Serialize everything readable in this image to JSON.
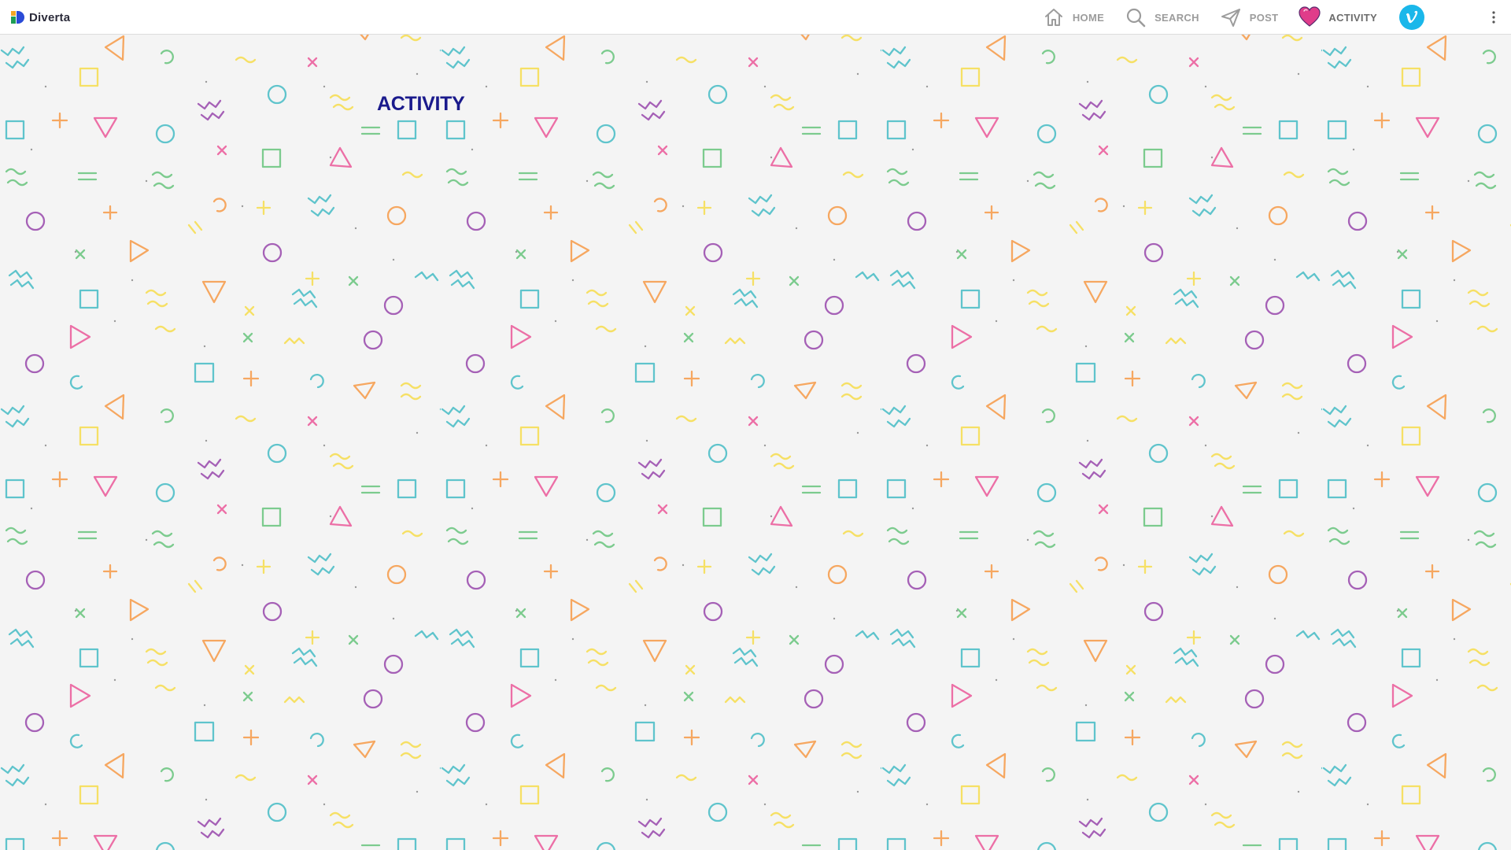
{
  "brand": {
    "name": "Diverta",
    "logo_colors": [
      "#f5a623",
      "#1f9d55",
      "#2a4bd7"
    ]
  },
  "nav": {
    "items": [
      {
        "label": "HOME",
        "icon": "home-icon"
      },
      {
        "label": "SEARCH",
        "icon": "search-icon"
      },
      {
        "label": "POST",
        "icon": "send-icon"
      },
      {
        "label": "ACTIVITY",
        "icon": "heart-icon"
      }
    ],
    "vimeo_icon": "vimeo-icon",
    "more_icon": "more-vertical-icon"
  },
  "page": {
    "title": "ACTIVITY"
  },
  "colors": {
    "background": "#f4f4f4",
    "topbar": "#ffffff",
    "title": "#1a1a8c",
    "nav_label": "#9c9c9c",
    "heart": "#e03c8a",
    "vimeo": "#1ab7ea",
    "pattern": [
      "#a560b6",
      "#5fc4cc",
      "#f6a760",
      "#f6e065",
      "#ec6fa6",
      "#7ccb8e"
    ]
  }
}
